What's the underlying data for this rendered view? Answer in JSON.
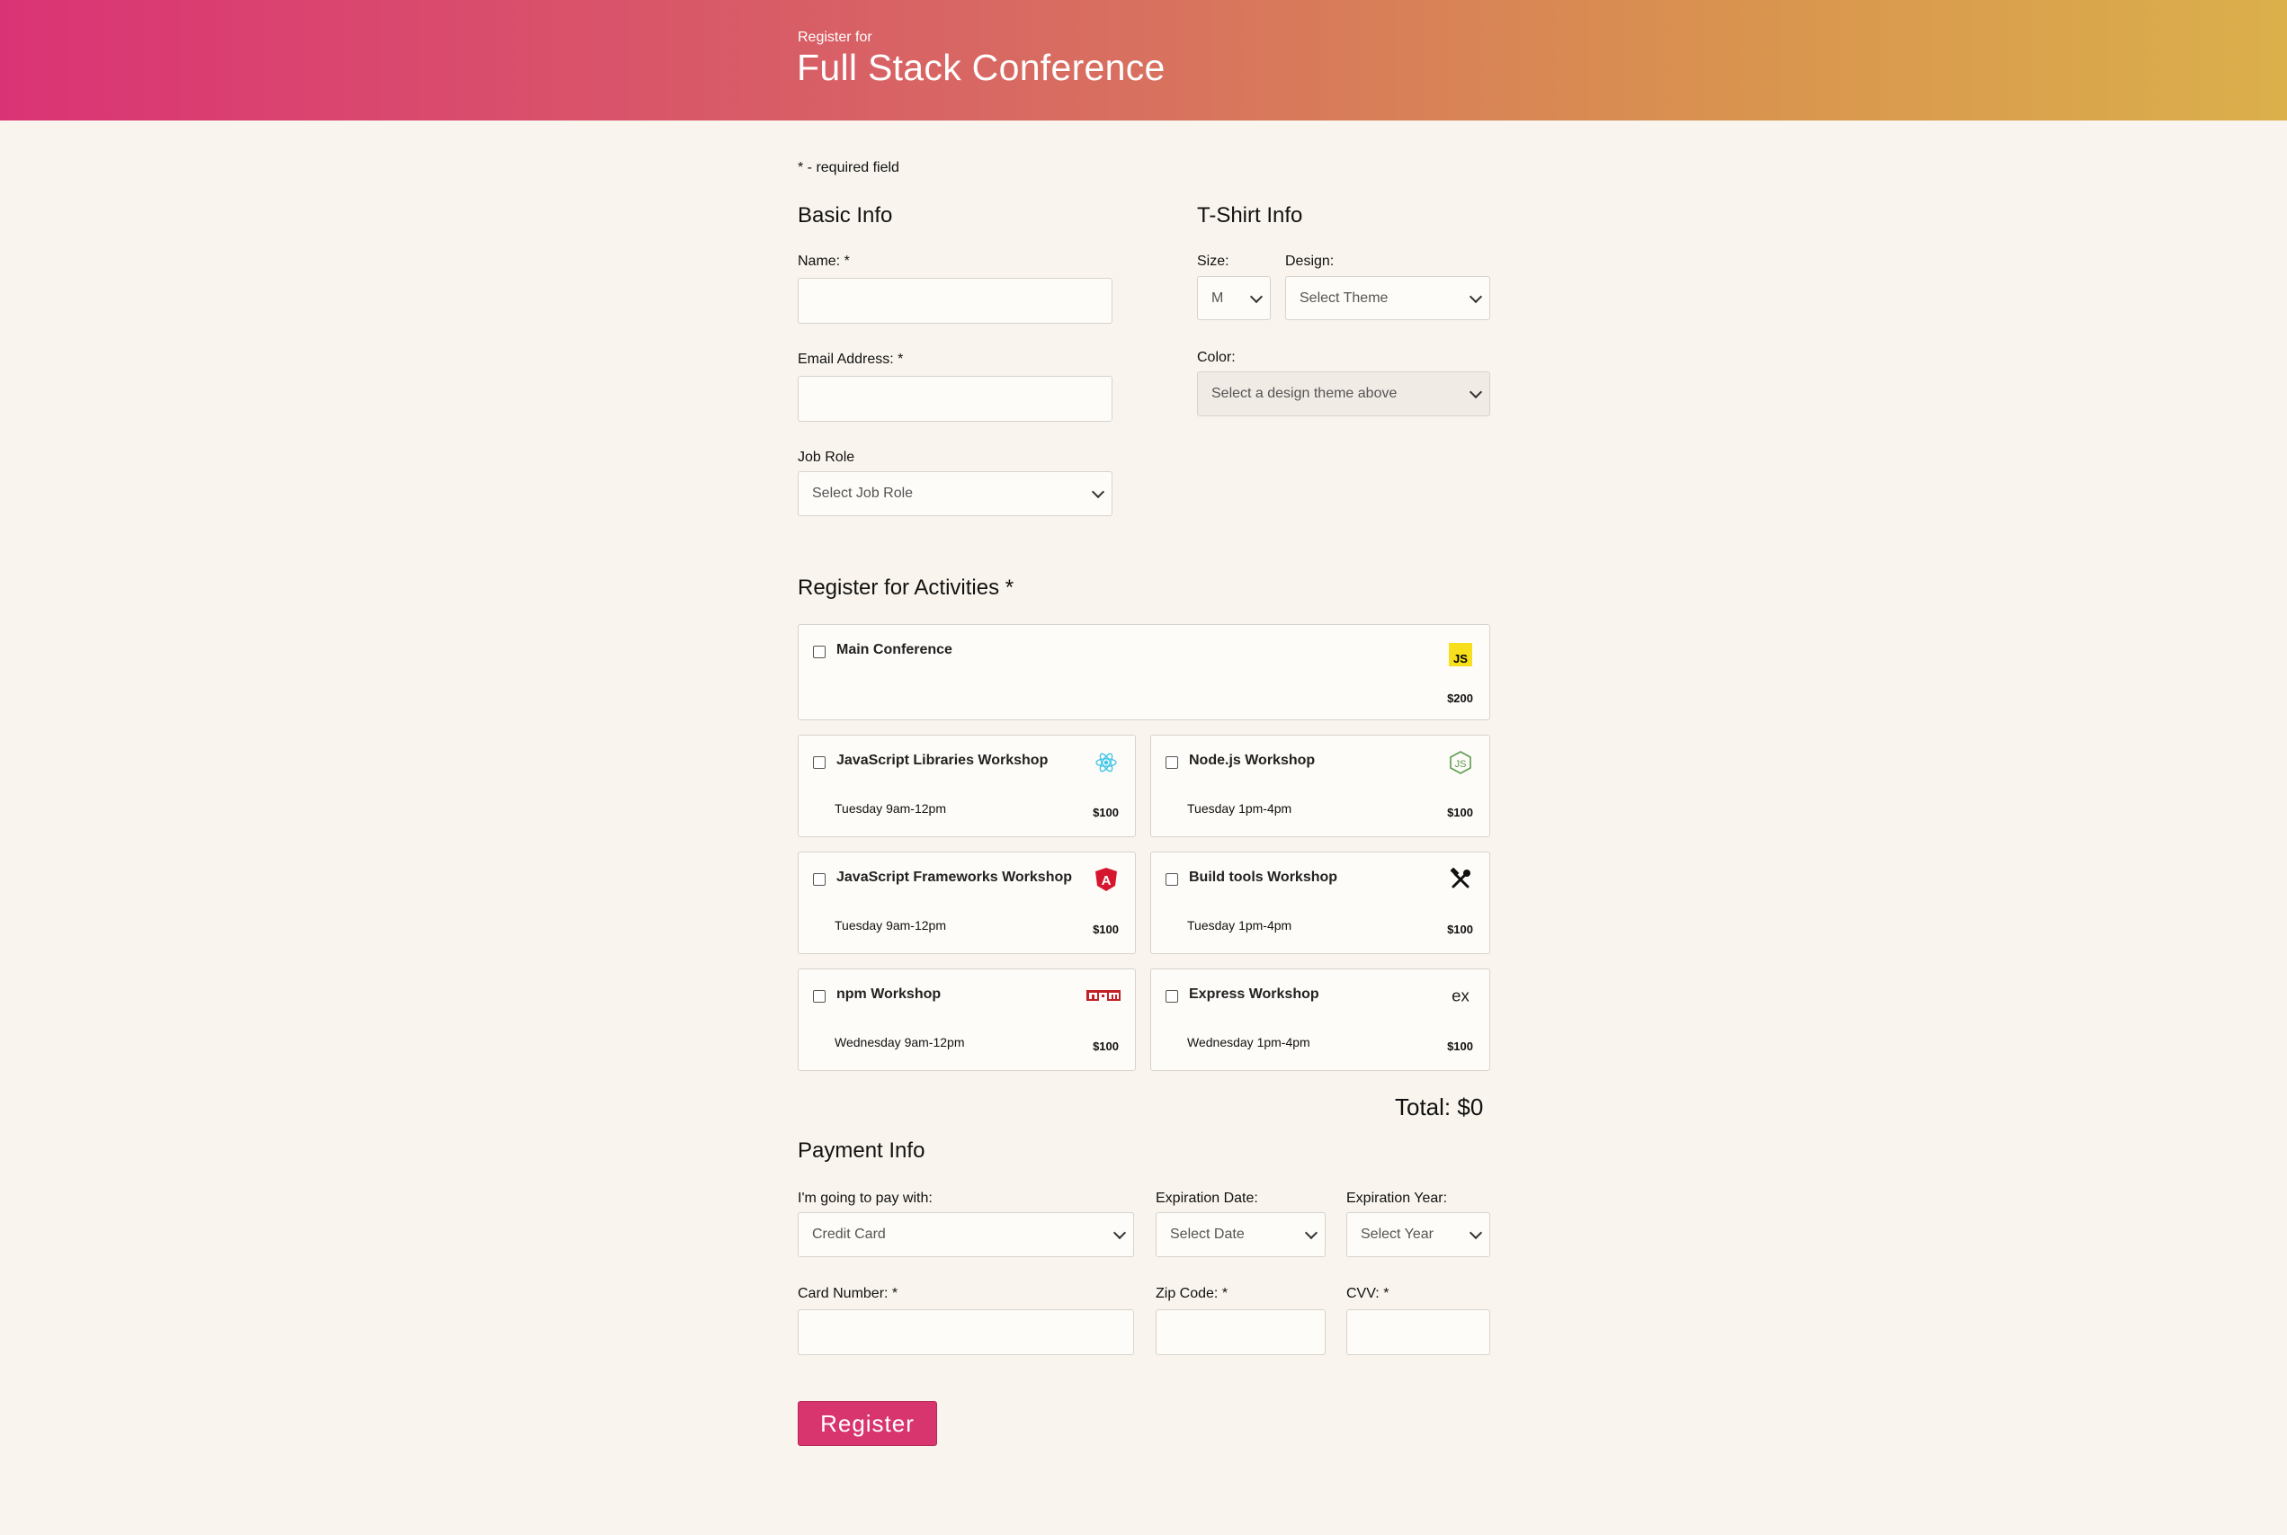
{
  "header": {
    "pre_title": "Register for",
    "title": "Full Stack Conference"
  },
  "required_note": "* - required field",
  "basic_info": {
    "heading": "Basic Info",
    "name_label": "Name: *",
    "name_value": "",
    "email_label": "Email Address: *",
    "email_value": "",
    "job_role_label": "Job Role",
    "job_role_selected": "Select Job Role"
  },
  "tshirt_info": {
    "heading": "T-Shirt Info",
    "size_label": "Size:",
    "size_selected": "M",
    "design_label": "Design:",
    "design_selected": "Select Theme",
    "color_label": "Color:",
    "color_selected": "Select a design theme above"
  },
  "activities": {
    "heading": "Register for Activities *",
    "items": [
      {
        "name": "Main Conference",
        "time": "",
        "cost": "$200",
        "icon": "js-icon",
        "checked": false
      },
      {
        "name": "JavaScript Libraries Workshop",
        "time": "Tuesday 9am-12pm",
        "cost": "$100",
        "icon": "react-icon",
        "checked": false
      },
      {
        "name": "Node.js Workshop",
        "time": "Tuesday 1pm-4pm",
        "cost": "$100",
        "icon": "nodejs-icon",
        "checked": false
      },
      {
        "name": "JavaScript Frameworks Workshop",
        "time": "Tuesday 9am-12pm",
        "cost": "$100",
        "icon": "angular-icon",
        "checked": false
      },
      {
        "name": "Build tools Workshop",
        "time": "Tuesday 1pm-4pm",
        "cost": "$100",
        "icon": "tools-icon",
        "checked": false
      },
      {
        "name": "npm Workshop",
        "time": "Wednesday 9am-12pm",
        "cost": "$100",
        "icon": "npm-icon",
        "checked": false
      },
      {
        "name": "Express Workshop",
        "time": "Wednesday 1pm-4pm",
        "cost": "$100",
        "icon": "express-icon",
        "checked": false
      }
    ],
    "total": "Total: $0"
  },
  "payment_info": {
    "heading": "Payment Info",
    "pay_with_label": "I'm going to pay with:",
    "pay_with_selected": "Credit Card",
    "exp_date_label": "Expiration Date:",
    "exp_date_selected": "Select Date",
    "exp_year_label": "Expiration Year:",
    "exp_year_selected": "Select Year",
    "card_number_label": "Card Number: *",
    "zip_label": "Zip Code: *",
    "cvv_label": "CVV: *"
  },
  "register_button": "Register",
  "colors": {
    "accent": "#d8356f",
    "page_bg": "#f9f5ee",
    "header_start": "#da3375",
    "header_end": "#dbb04b"
  }
}
